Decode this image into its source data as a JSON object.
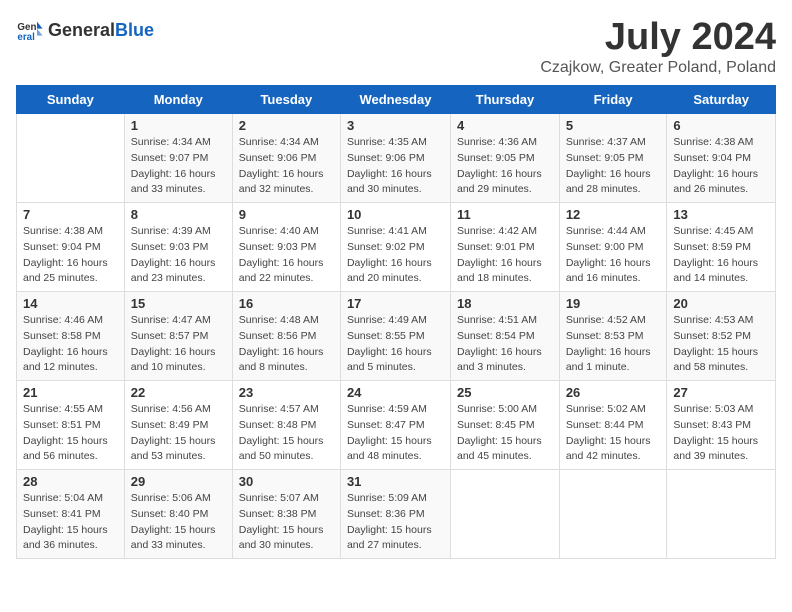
{
  "header": {
    "logo_general": "General",
    "logo_blue": "Blue",
    "title": "July 2024",
    "subtitle": "Czajkow, Greater Poland, Poland"
  },
  "calendar": {
    "days_of_week": [
      "Sunday",
      "Monday",
      "Tuesday",
      "Wednesday",
      "Thursday",
      "Friday",
      "Saturday"
    ],
    "weeks": [
      [
        {
          "day": "",
          "info": ""
        },
        {
          "day": "1",
          "info": "Sunrise: 4:34 AM\nSunset: 9:07 PM\nDaylight: 16 hours\nand 33 minutes."
        },
        {
          "day": "2",
          "info": "Sunrise: 4:34 AM\nSunset: 9:06 PM\nDaylight: 16 hours\nand 32 minutes."
        },
        {
          "day": "3",
          "info": "Sunrise: 4:35 AM\nSunset: 9:06 PM\nDaylight: 16 hours\nand 30 minutes."
        },
        {
          "day": "4",
          "info": "Sunrise: 4:36 AM\nSunset: 9:05 PM\nDaylight: 16 hours\nand 29 minutes."
        },
        {
          "day": "5",
          "info": "Sunrise: 4:37 AM\nSunset: 9:05 PM\nDaylight: 16 hours\nand 28 minutes."
        },
        {
          "day": "6",
          "info": "Sunrise: 4:38 AM\nSunset: 9:04 PM\nDaylight: 16 hours\nand 26 minutes."
        }
      ],
      [
        {
          "day": "7",
          "info": "Sunrise: 4:38 AM\nSunset: 9:04 PM\nDaylight: 16 hours\nand 25 minutes."
        },
        {
          "day": "8",
          "info": "Sunrise: 4:39 AM\nSunset: 9:03 PM\nDaylight: 16 hours\nand 23 minutes."
        },
        {
          "day": "9",
          "info": "Sunrise: 4:40 AM\nSunset: 9:03 PM\nDaylight: 16 hours\nand 22 minutes."
        },
        {
          "day": "10",
          "info": "Sunrise: 4:41 AM\nSunset: 9:02 PM\nDaylight: 16 hours\nand 20 minutes."
        },
        {
          "day": "11",
          "info": "Sunrise: 4:42 AM\nSunset: 9:01 PM\nDaylight: 16 hours\nand 18 minutes."
        },
        {
          "day": "12",
          "info": "Sunrise: 4:44 AM\nSunset: 9:00 PM\nDaylight: 16 hours\nand 16 minutes."
        },
        {
          "day": "13",
          "info": "Sunrise: 4:45 AM\nSunset: 8:59 PM\nDaylight: 16 hours\nand 14 minutes."
        }
      ],
      [
        {
          "day": "14",
          "info": "Sunrise: 4:46 AM\nSunset: 8:58 PM\nDaylight: 16 hours\nand 12 minutes."
        },
        {
          "day": "15",
          "info": "Sunrise: 4:47 AM\nSunset: 8:57 PM\nDaylight: 16 hours\nand 10 minutes."
        },
        {
          "day": "16",
          "info": "Sunrise: 4:48 AM\nSunset: 8:56 PM\nDaylight: 16 hours\nand 8 minutes."
        },
        {
          "day": "17",
          "info": "Sunrise: 4:49 AM\nSunset: 8:55 PM\nDaylight: 16 hours\nand 5 minutes."
        },
        {
          "day": "18",
          "info": "Sunrise: 4:51 AM\nSunset: 8:54 PM\nDaylight: 16 hours\nand 3 minutes."
        },
        {
          "day": "19",
          "info": "Sunrise: 4:52 AM\nSunset: 8:53 PM\nDaylight: 16 hours\nand 1 minute."
        },
        {
          "day": "20",
          "info": "Sunrise: 4:53 AM\nSunset: 8:52 PM\nDaylight: 15 hours\nand 58 minutes."
        }
      ],
      [
        {
          "day": "21",
          "info": "Sunrise: 4:55 AM\nSunset: 8:51 PM\nDaylight: 15 hours\nand 56 minutes."
        },
        {
          "day": "22",
          "info": "Sunrise: 4:56 AM\nSunset: 8:49 PM\nDaylight: 15 hours\nand 53 minutes."
        },
        {
          "day": "23",
          "info": "Sunrise: 4:57 AM\nSunset: 8:48 PM\nDaylight: 15 hours\nand 50 minutes."
        },
        {
          "day": "24",
          "info": "Sunrise: 4:59 AM\nSunset: 8:47 PM\nDaylight: 15 hours\nand 48 minutes."
        },
        {
          "day": "25",
          "info": "Sunrise: 5:00 AM\nSunset: 8:45 PM\nDaylight: 15 hours\nand 45 minutes."
        },
        {
          "day": "26",
          "info": "Sunrise: 5:02 AM\nSunset: 8:44 PM\nDaylight: 15 hours\nand 42 minutes."
        },
        {
          "day": "27",
          "info": "Sunrise: 5:03 AM\nSunset: 8:43 PM\nDaylight: 15 hours\nand 39 minutes."
        }
      ],
      [
        {
          "day": "28",
          "info": "Sunrise: 5:04 AM\nSunset: 8:41 PM\nDaylight: 15 hours\nand 36 minutes."
        },
        {
          "day": "29",
          "info": "Sunrise: 5:06 AM\nSunset: 8:40 PM\nDaylight: 15 hours\nand 33 minutes."
        },
        {
          "day": "30",
          "info": "Sunrise: 5:07 AM\nSunset: 8:38 PM\nDaylight: 15 hours\nand 30 minutes."
        },
        {
          "day": "31",
          "info": "Sunrise: 5:09 AM\nSunset: 8:36 PM\nDaylight: 15 hours\nand 27 minutes."
        },
        {
          "day": "",
          "info": ""
        },
        {
          "day": "",
          "info": ""
        },
        {
          "day": "",
          "info": ""
        }
      ]
    ]
  }
}
